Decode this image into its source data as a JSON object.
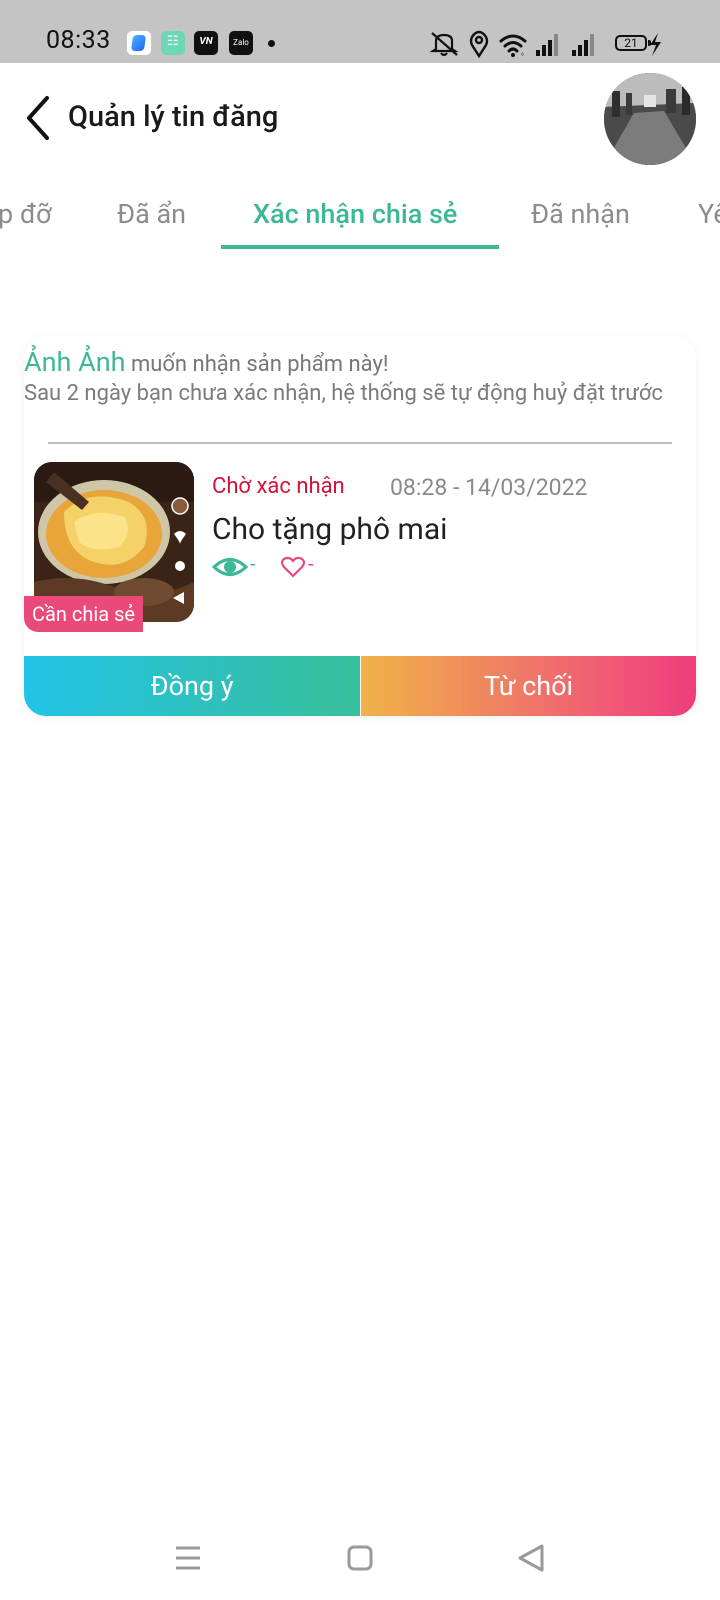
{
  "status_bar": {
    "time": "08:33",
    "app_icons": [
      "browser-icon",
      "market-icon",
      "news-icon",
      "zalo-icon"
    ],
    "app_icon_text": {
      "market": "☷",
      "news": "VN",
      "zalo": "Zalo"
    },
    "battery_level": "21",
    "icons": [
      "mute-icon",
      "location-icon",
      "wifi-icon",
      "signal-icon",
      "signal-icon",
      "battery-icon",
      "charging-icon"
    ]
  },
  "header": {
    "title": "Quản lý tin đăng",
    "back_icon": "chevron-left-icon"
  },
  "tabs": [
    {
      "label": "p đỡ",
      "active": false
    },
    {
      "label": "Đã ẩn",
      "active": false
    },
    {
      "label": "Xác nhận chia sẻ",
      "active": true
    },
    {
      "label": "Đã nhận",
      "active": false
    },
    {
      "label": "Yê",
      "active": false
    }
  ],
  "card": {
    "requester_name": "Ảnh Ảnh",
    "request_text": "muốn nhận sản phẩm này!",
    "auto_cancel_text": "Sau 2 ngày bạn chưa xác nhận, hệ thống sẽ tự động huỷ đặt trước",
    "badge": "Cần chia sẻ",
    "status": "Chờ xác nhận",
    "datetime": "08:28 - 14/03/2022",
    "title": "Cho tặng phô mai",
    "views": "-",
    "likes": "-",
    "accept_label": "Đồng ý",
    "reject_label": "Từ chối"
  },
  "colors": {
    "accent": "#3eb894",
    "status_red": "#d0153d",
    "badge_pink": "#ea4a7a"
  },
  "bottom_nav": [
    "menu-icon",
    "home-square-icon",
    "back-triangle-icon"
  ]
}
